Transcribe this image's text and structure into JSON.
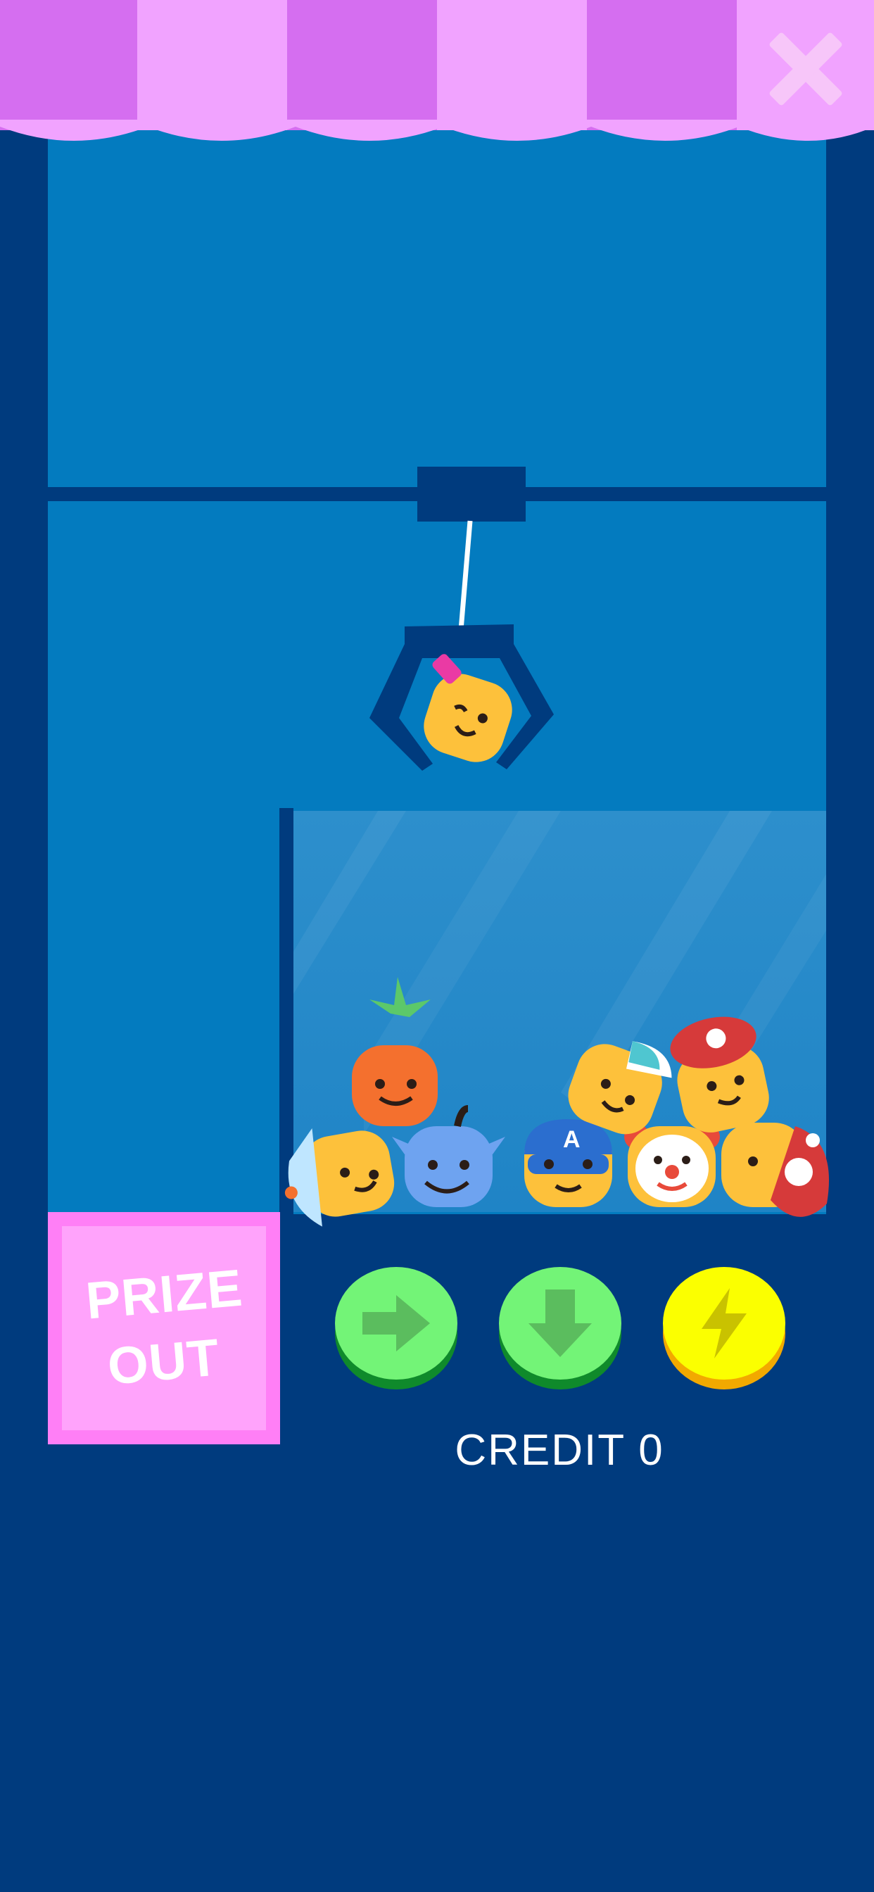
{
  "colors": {
    "frame": "#003b7e",
    "play_area": "#037bbf",
    "awning_light": "#f1a3ff",
    "awning_dark": "#d56ef0",
    "prize_out_border": "#ff7ff6",
    "prize_out_fill": "#ffa3fb",
    "button_green": "#73f477",
    "button_green_shadow": "#0f8a2b",
    "button_yellow": "#fbff00",
    "button_yellow_shadow": "#f2a900"
  },
  "header": {
    "close_icon": "close-icon"
  },
  "prize_out": {
    "line1": "PRIZE",
    "line2": "OUT"
  },
  "controls": {
    "right_icon": "arrow-right-icon",
    "down_icon": "arrow-down-icon",
    "power_icon": "lightning-icon"
  },
  "credit": {
    "text": "CREDIT 0"
  }
}
